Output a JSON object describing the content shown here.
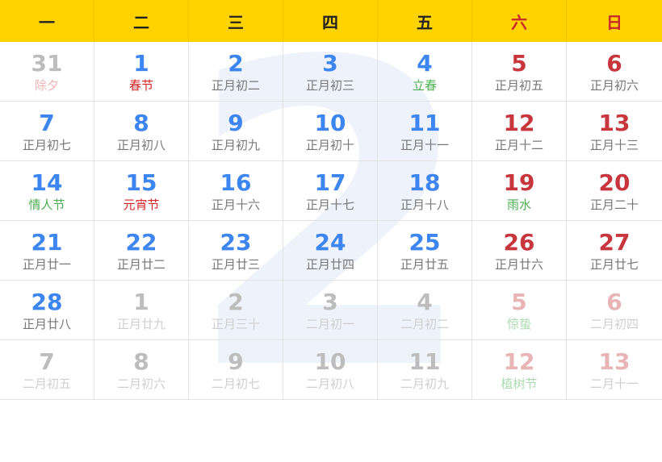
{
  "watermark": "2",
  "weekdays": [
    "一",
    "二",
    "三",
    "四",
    "五",
    "六",
    "日"
  ],
  "rows": [
    [
      {
        "day": "31",
        "lunar": "除夕"
      },
      {
        "day": "1",
        "lunar": "春节"
      },
      {
        "day": "2",
        "lunar": "正月初二"
      },
      {
        "day": "3",
        "lunar": "正月初三"
      },
      {
        "day": "4",
        "lunar": "立春"
      },
      {
        "day": "5",
        "lunar": "正月初五"
      },
      {
        "day": "6",
        "lunar": "正月初六"
      }
    ],
    [
      {
        "day": "7",
        "lunar": "正月初七"
      },
      {
        "day": "8",
        "lunar": "正月初八"
      },
      {
        "day": "9",
        "lunar": "正月初九"
      },
      {
        "day": "10",
        "lunar": "正月初十"
      },
      {
        "day": "11",
        "lunar": "正月十一"
      },
      {
        "day": "12",
        "lunar": "正月十二"
      },
      {
        "day": "13",
        "lunar": "正月十三"
      }
    ],
    [
      {
        "day": "14",
        "lunar": "情人节"
      },
      {
        "day": "15",
        "lunar": "元宵节"
      },
      {
        "day": "16",
        "lunar": "正月十六"
      },
      {
        "day": "17",
        "lunar": "正月十七"
      },
      {
        "day": "18",
        "lunar": "正月十八"
      },
      {
        "day": "19",
        "lunar": "雨水"
      },
      {
        "day": "20",
        "lunar": "正月二十"
      }
    ],
    [
      {
        "day": "21",
        "lunar": "正月廿一"
      },
      {
        "day": "22",
        "lunar": "正月廿二"
      },
      {
        "day": "23",
        "lunar": "正月廿三"
      },
      {
        "day": "24",
        "lunar": "正月廿四"
      },
      {
        "day": "25",
        "lunar": "正月廿五"
      },
      {
        "day": "26",
        "lunar": "正月廿六"
      },
      {
        "day": "27",
        "lunar": "正月廿七"
      }
    ],
    [
      {
        "day": "28",
        "lunar": "正月廿八"
      },
      {
        "day": "1",
        "lunar": "正月廿九"
      },
      {
        "day": "2",
        "lunar": "正月三十"
      },
      {
        "day": "3",
        "lunar": "二月初一"
      },
      {
        "day": "4",
        "lunar": "二月初二"
      },
      {
        "day": "5",
        "lunar": "惊蛰"
      },
      {
        "day": "6",
        "lunar": "二月初四"
      }
    ],
    [
      {
        "day": "7",
        "lunar": "二月初五"
      },
      {
        "day": "8",
        "lunar": "二月初六"
      },
      {
        "day": "9",
        "lunar": "二月初七"
      },
      {
        "day": "10",
        "lunar": "二月初八"
      },
      {
        "day": "11",
        "lunar": "二月初九"
      },
      {
        "day": "12",
        "lunar": "植树节"
      },
      {
        "day": "13",
        "lunar": "二月十一"
      }
    ]
  ],
  "colors": {
    "header_bg": "#ffd200",
    "current_day": "#3d85f0",
    "weekend_day": "#c8363d",
    "festival": "#d42424",
    "solar_term": "#4caf50",
    "other_month": "#bdbdbd"
  }
}
